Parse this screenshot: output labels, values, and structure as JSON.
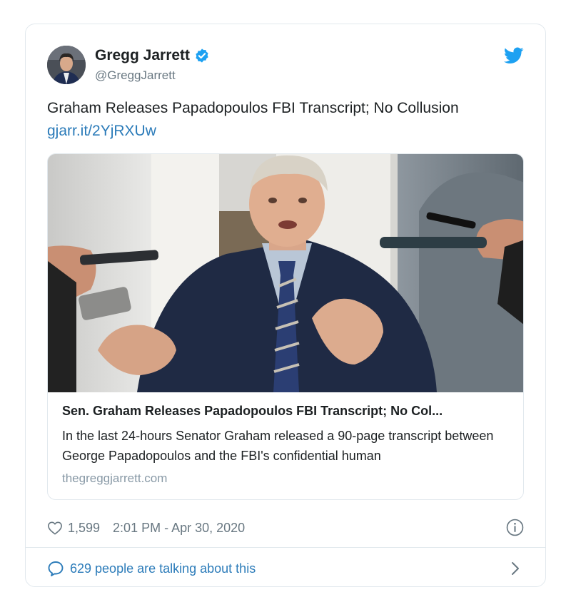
{
  "author": {
    "name": "Gregg Jarrett",
    "handle": "@GreggJarrett",
    "verified": true
  },
  "tweet": {
    "text": "Graham Releases Papadopoulos FBI Transcript; No Collusion",
    "link": "gjarr.it/2YjRXUw"
  },
  "link_card": {
    "title": "Sen. Graham Releases Papadopoulos FBI Transcript; No Col...",
    "description": "In the last 24-hours Senator Graham released a 90-page transcript between George Papadopoulos and the FBI's confidential human",
    "domain": "thegreggjarrett.com"
  },
  "footer": {
    "likes": "1,599",
    "timestamp": "2:01 PM - Apr 30, 2020"
  },
  "conversation": {
    "label": "629 people are talking about this"
  },
  "colors": {
    "link": "#2b7bb9",
    "verified": "#1da1f2",
    "twitter_bird": "#1da1f2",
    "muted": "#697882",
    "border": "#e1e8ed"
  },
  "icons": [
    "verified-badge-icon",
    "twitter-bird-icon",
    "heart-icon",
    "info-icon",
    "comment-bubble-icon",
    "chevron-right-icon"
  ]
}
